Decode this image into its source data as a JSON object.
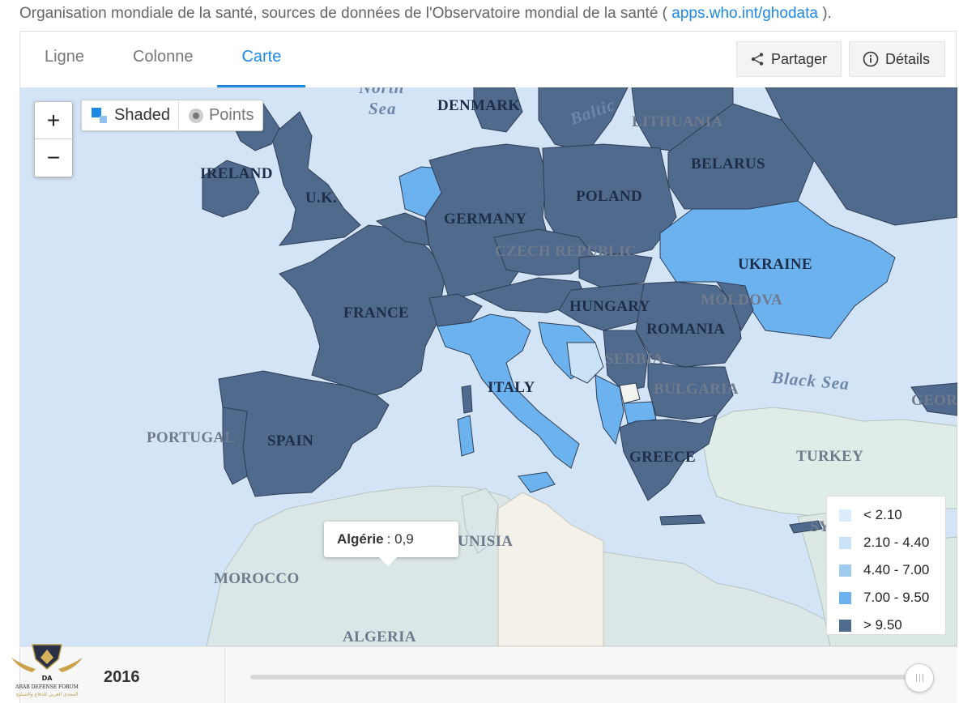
{
  "source": {
    "prefix": "Organisation mondiale de la santé, sources de données de l'Observatoire mondial de la santé (",
    "link": "apps.who.int/ghodata",
    "suffix": ")."
  },
  "tabs": [
    {
      "label": "Ligne",
      "active": false
    },
    {
      "label": "Colonne",
      "active": false
    },
    {
      "label": "Carte",
      "active": true
    }
  ],
  "actions": {
    "share": "Partager",
    "details": "Détails"
  },
  "zoom": {
    "in": "+",
    "out": "−"
  },
  "map_mode": {
    "shaded": "Shaded",
    "points": "Points",
    "selected": "Shaded"
  },
  "map_labels": {
    "north_sea": "North",
    "north_sea_2": "Sea",
    "denmark": "DENMARK",
    "baltic": "Baltic",
    "lithuania": "LITHUANIA",
    "belarus": "BELARUS",
    "ireland": "IRELAND",
    "uk": "U.K.",
    "poland": "POLAND",
    "germany": "GERMANY",
    "czech": "CZECH REPUBLIC",
    "ukraine": "UKRAINE",
    "moldova": "MOLDOVA",
    "france": "FRANCE",
    "hungary": "HUNGARY",
    "romania": "ROMANIA",
    "serbia": "SERBIA",
    "black_sea": "Black Sea",
    "italy": "ITALY",
    "bulgaria": "BULGARIA",
    "georgia": "GEORG",
    "portugal": "PORTUGAL",
    "spain": "SPAIN",
    "turkey": "TURKEY",
    "greece": "GREECE",
    "tunisia": "UNISIA",
    "syria": "SYR",
    "morocco": "MOROCCO",
    "algeria": "ALGERIA"
  },
  "tooltip": {
    "country": "Algérie",
    "separator": ":",
    "value": "0,9"
  },
  "legend": [
    {
      "label": "< 2.10",
      "color": "#dcecfb"
    },
    {
      "label": "2.10 - 4.40",
      "color": "#c9e2f6"
    },
    {
      "label": "4.40 - 7.00",
      "color": "#9fcbec"
    },
    {
      "label": "7.00 - 9.50",
      "color": "#6bb2ee"
    },
    {
      "label": "> 9.50",
      "color": "#4f6a8d"
    }
  ],
  "timeline": {
    "year": "2016"
  },
  "watermark": {
    "line1": "ARAB DEFENSE FORUM",
    "line2": "المنتدى العربي للدفاع والتسليح",
    "initials": "DA"
  }
}
